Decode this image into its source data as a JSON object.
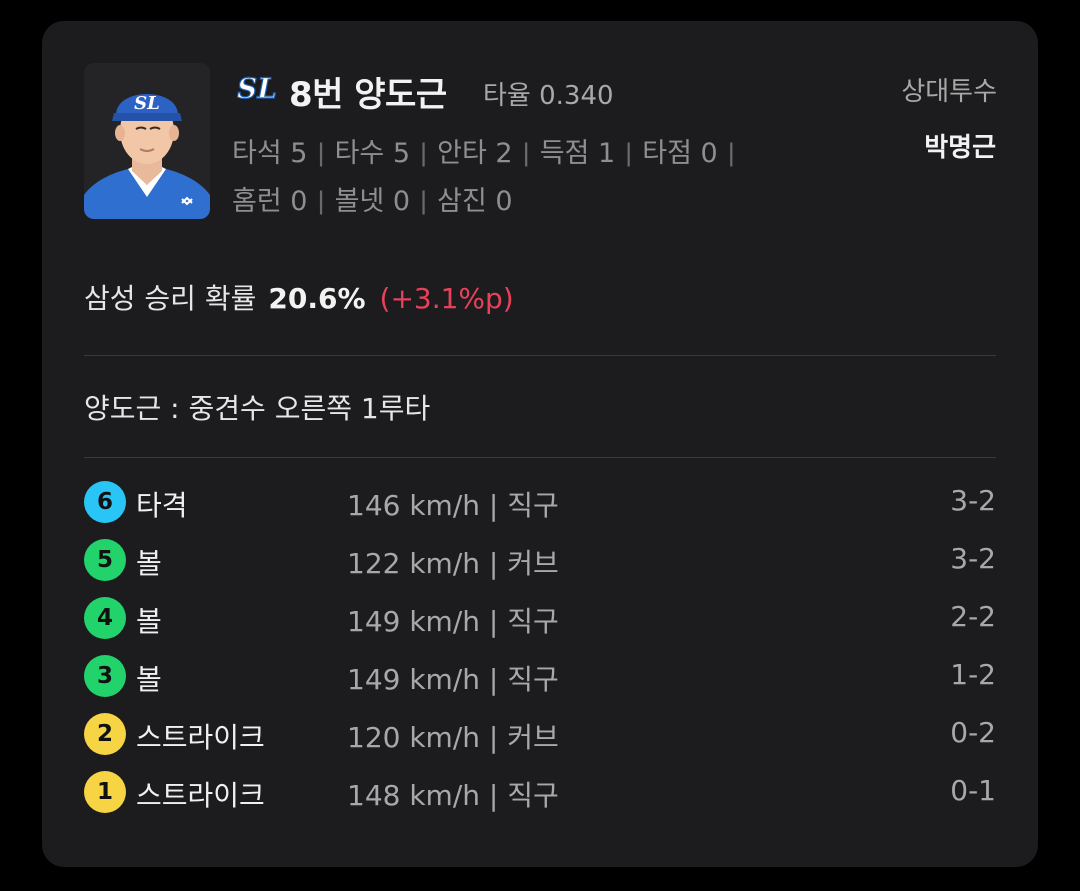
{
  "player": {
    "name": "8번 양도근",
    "batting_avg": "타율 0.340",
    "team_logo_icon": "samsung-lions-logo-icon",
    "stats_line1": [
      "타석 5",
      "타수 5",
      "안타 2",
      "득점 1",
      "타점 0"
    ],
    "stats_line2": [
      "홈런 0",
      "볼넷 0",
      "삼진 0"
    ]
  },
  "opponent": {
    "label": "상대투수",
    "name": "박명근"
  },
  "win_probability": {
    "label": "삼성 승리 확률",
    "value": "20.6%",
    "delta": "(+3.1%p)"
  },
  "play_description": "양도근 : 중견수 오른쪽 1루타",
  "pitches": [
    {
      "num": "6",
      "result": "타격",
      "info": "146 km/h | 직구",
      "count": "3-2",
      "color": "#29c5f6"
    },
    {
      "num": "5",
      "result": "볼",
      "info": "122 km/h | 커브",
      "count": "3-2",
      "color": "#22d36b"
    },
    {
      "num": "4",
      "result": "볼",
      "info": "149 km/h | 직구",
      "count": "2-2",
      "color": "#22d36b"
    },
    {
      "num": "3",
      "result": "볼",
      "info": "149 km/h | 직구",
      "count": "1-2",
      "color": "#22d36b"
    },
    {
      "num": "2",
      "result": "스트라이크",
      "info": "120 km/h | 커브",
      "count": "0-2",
      "color": "#f7d443"
    },
    {
      "num": "1",
      "result": "스트라이크",
      "info": "148 km/h | 직구",
      "count": "0-1",
      "color": "#f7d443"
    }
  ],
  "colors": {
    "card_bg": "#1c1c1e",
    "delta_red": "#e8415a",
    "team_blue": "#1a5fb4"
  }
}
